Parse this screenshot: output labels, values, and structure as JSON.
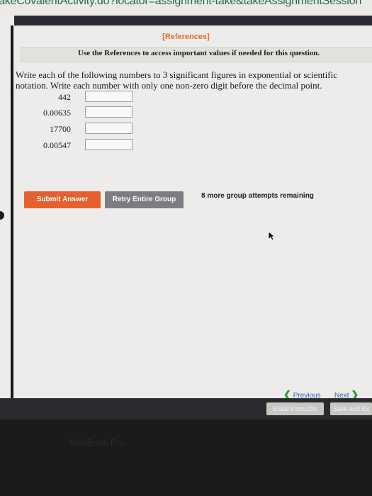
{
  "browser": {
    "url_fragment": "akeCovalentActivity.do?locator=assignment-take&takeAssignmentSession"
  },
  "page": {
    "references_link": "[References]",
    "references_note": "Use the References to access important values if needed for this question.",
    "instructions": "Write each of the following numbers to 3 significant figures in exponential or scientific notation. Write each number with only one non-zero digit before the decimal point."
  },
  "questions": [
    {
      "number": "442",
      "answer": ""
    },
    {
      "number": "0.00635",
      "answer": ""
    },
    {
      "number": "17700",
      "answer": ""
    },
    {
      "number": "0.00547",
      "answer": ""
    }
  ],
  "actions": {
    "submit_label": "Submit Answer",
    "retry_label": "Retry Entire Group",
    "attempts_text": "8 more group attempts remaining"
  },
  "navigation": {
    "prev_chevron": "❮",
    "prev_label": "Previous",
    "next_label": "Next",
    "next_chevron": "❯"
  },
  "footer": {
    "email_label": "Email Instructor",
    "save_label": "Save and Ex"
  },
  "device": {
    "bezel_label": "MacBook Pro"
  },
  "colors": {
    "accent": "#e5602d",
    "retry": "#7c7c82",
    "link": "#2e5fb0",
    "nav_arrow": "#2a9a2a"
  },
  "icons": {
    "cursor": "mouse-pointer-icon",
    "previous": "chevron-left-icon",
    "next": "chevron-right-icon"
  }
}
